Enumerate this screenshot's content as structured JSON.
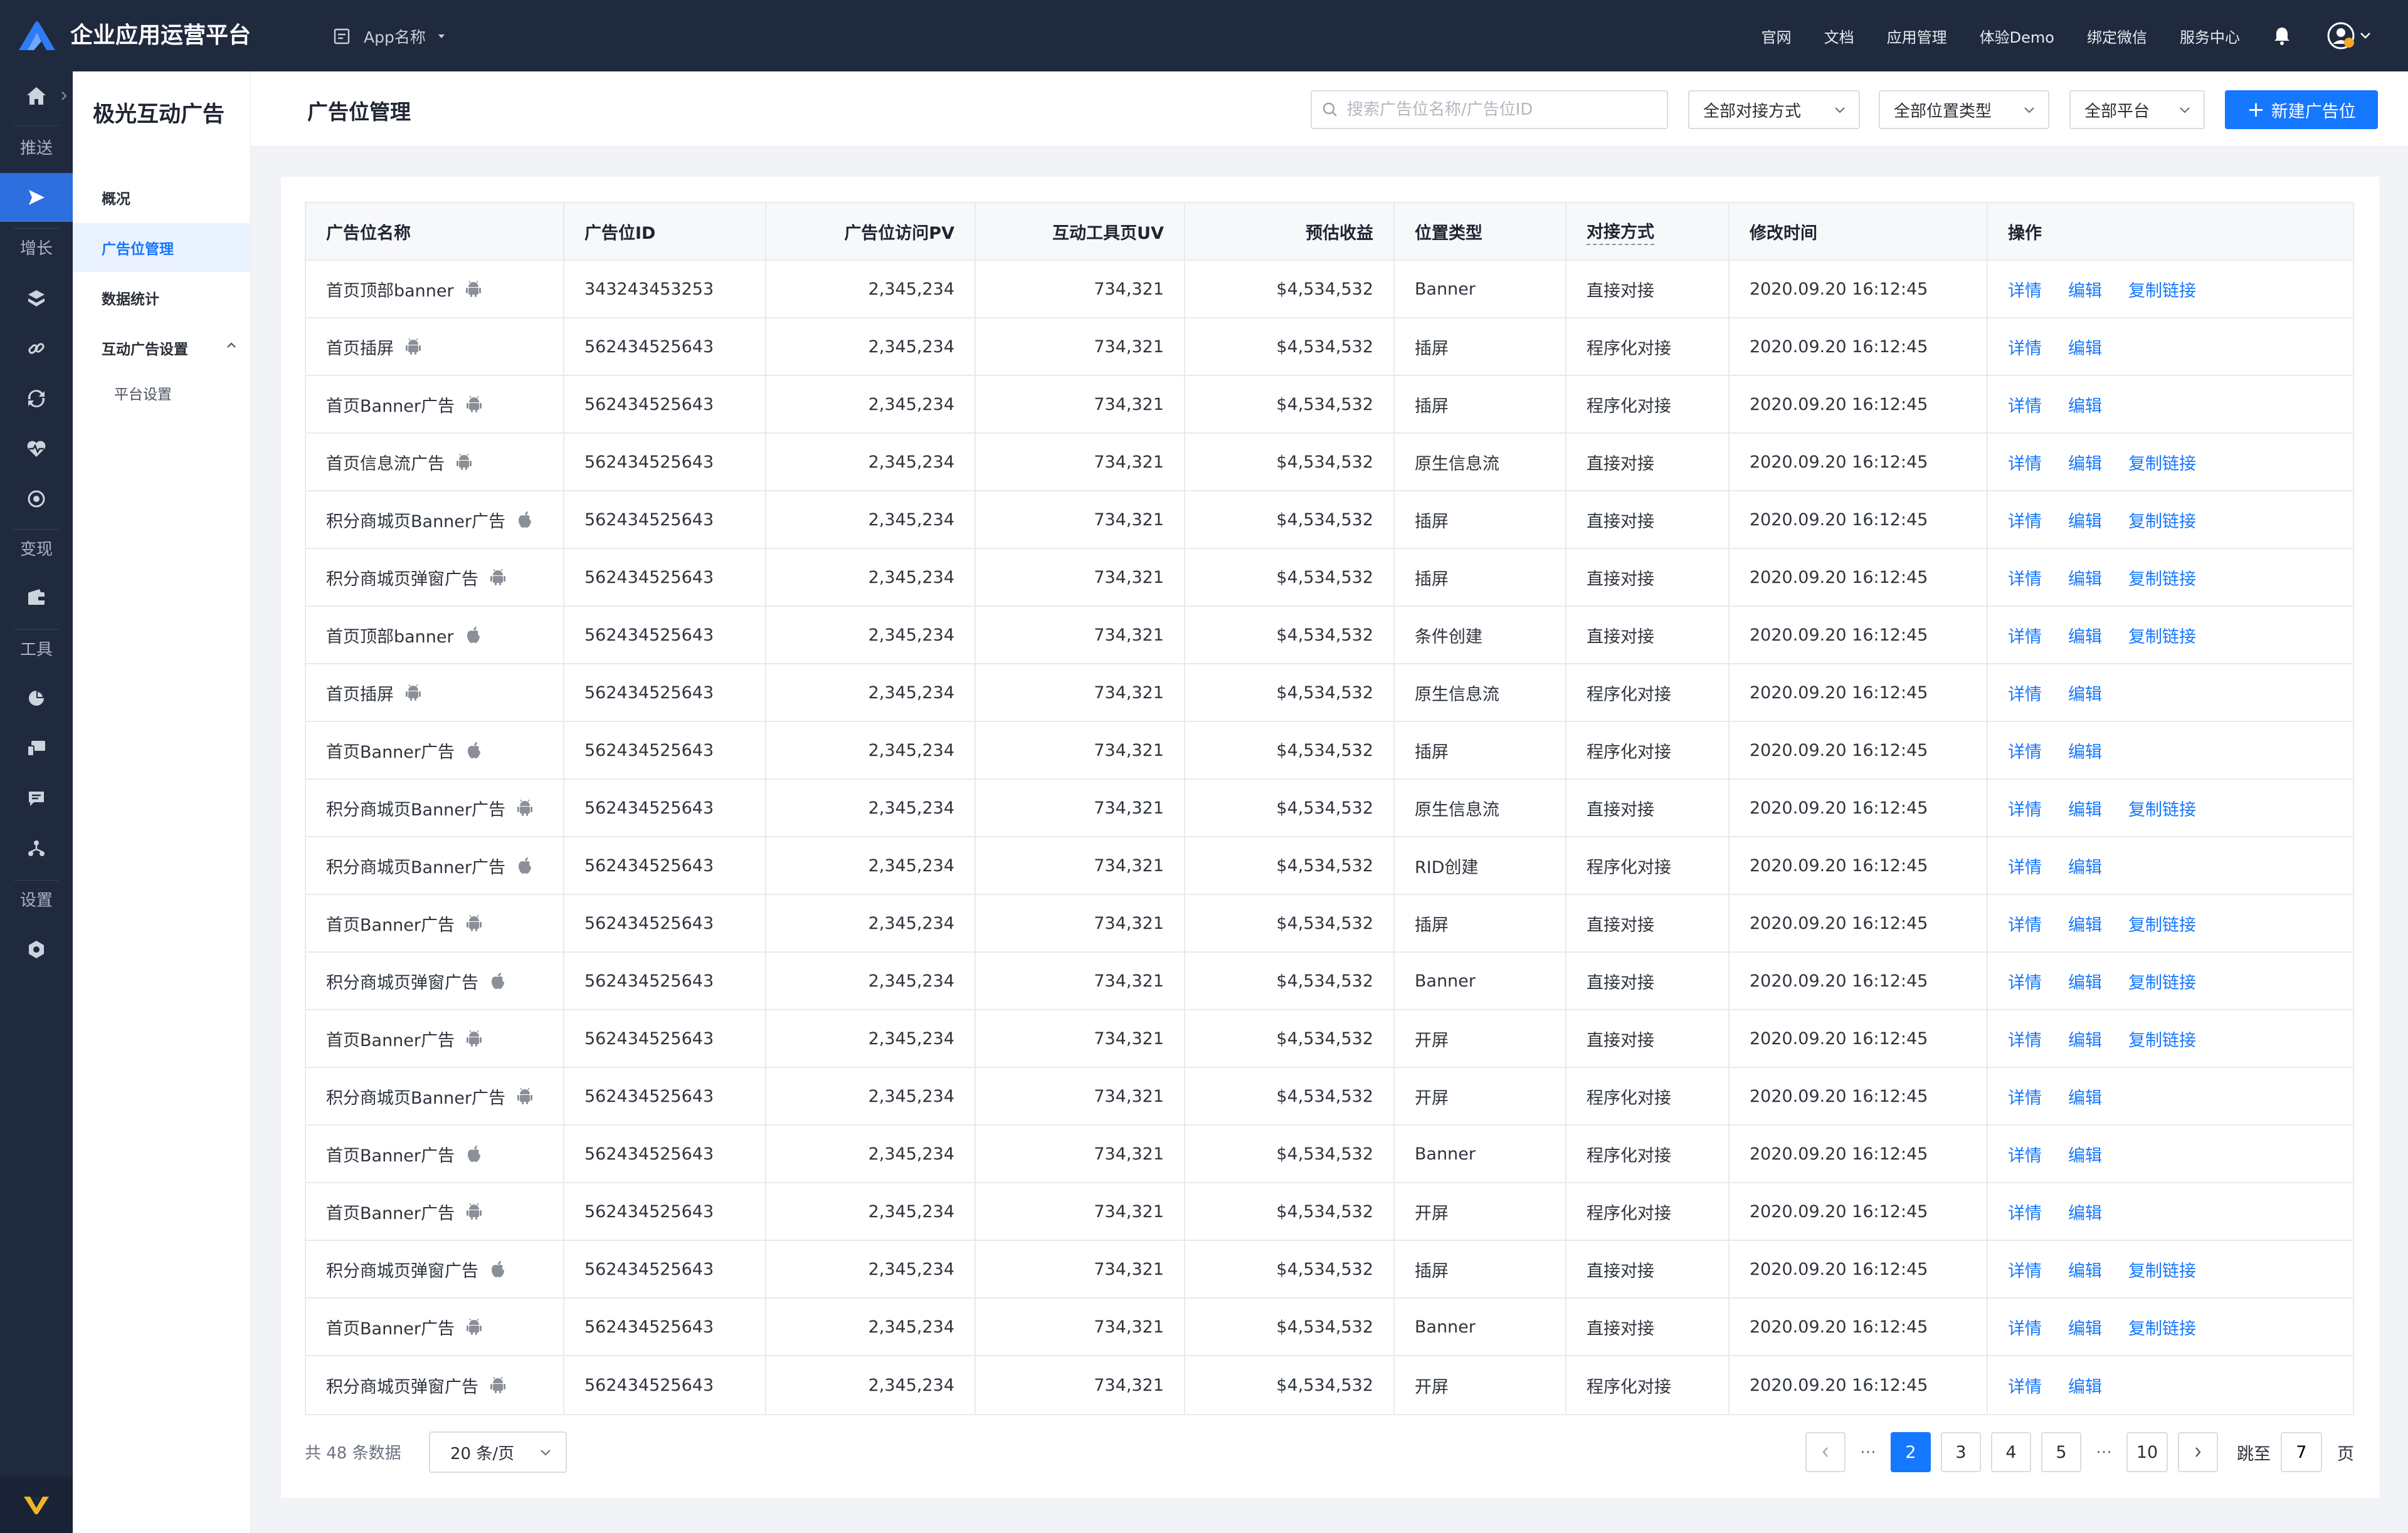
{
  "app": {
    "brand": "企业应用运营平台",
    "app_selector": "App名称",
    "nav": [
      "官网",
      "文档",
      "应用管理",
      "体验Demo",
      "绑定微信",
      "服务中心"
    ]
  },
  "rail": {
    "labels": {
      "push": "推送",
      "growth": "增长",
      "monetize": "变现",
      "tools": "工具",
      "settings": "设置"
    }
  },
  "sidebar": {
    "title": "极光互动广告",
    "items": [
      {
        "label": "概况"
      },
      {
        "label": "广告位管理"
      },
      {
        "label": "数据统计"
      },
      {
        "label": "互动广告设置"
      },
      {
        "label": "平台设置"
      }
    ]
  },
  "header": {
    "title": "广告位管理",
    "search_placeholder": "搜索广告位名称/广告位ID",
    "filter_connect": "全部对接方式",
    "filter_position": "全部位置类型",
    "filter_platform": "全部平台",
    "new_button": "新建广告位"
  },
  "table": {
    "columns": [
      "广告位名称",
      "广告位ID",
      "广告位访问PV",
      "互动工具页UV",
      "预估收益",
      "位置类型",
      "对接方式",
      "修改时间",
      "操作"
    ],
    "actions": {
      "detail": "详情",
      "edit": "编辑",
      "copy": "复制链接"
    },
    "rows": [
      {
        "name": "首页顶部banner",
        "platform": "android",
        "id": "343243453253",
        "pv": "2,345,234",
        "uv": "734,321",
        "revenue": "$4,534,532",
        "type": "Banner",
        "connect": "直接对接",
        "time": "2020.09.20 16:12:45",
        "copy": true
      },
      {
        "name": "首页插屏",
        "platform": "android",
        "id": "562434525643",
        "pv": "2,345,234",
        "uv": "734,321",
        "revenue": "$4,534,532",
        "type": "插屏",
        "connect": "程序化对接",
        "time": "2020.09.20 16:12:45",
        "copy": false
      },
      {
        "name": "首页Banner广告",
        "platform": "android",
        "id": "562434525643",
        "pv": "2,345,234",
        "uv": "734,321",
        "revenue": "$4,534,532",
        "type": "插屏",
        "connect": "程序化对接",
        "time": "2020.09.20 16:12:45",
        "copy": false
      },
      {
        "name": "首页信息流广告",
        "platform": "android",
        "id": "562434525643",
        "pv": "2,345,234",
        "uv": "734,321",
        "revenue": "$4,534,532",
        "type": "原生信息流",
        "connect": "直接对接",
        "time": "2020.09.20 16:12:45",
        "copy": true
      },
      {
        "name": "积分商城页Banner广告",
        "platform": "apple",
        "id": "562434525643",
        "pv": "2,345,234",
        "uv": "734,321",
        "revenue": "$4,534,532",
        "type": "插屏",
        "connect": "直接对接",
        "time": "2020.09.20 16:12:45",
        "copy": true
      },
      {
        "name": "积分商城页弹窗广告",
        "platform": "android",
        "id": "562434525643",
        "pv": "2,345,234",
        "uv": "734,321",
        "revenue": "$4,534,532",
        "type": "插屏",
        "connect": "直接对接",
        "time": "2020.09.20 16:12:45",
        "copy": true
      },
      {
        "name": "首页顶部banner",
        "platform": "apple",
        "id": "562434525643",
        "pv": "2,345,234",
        "uv": "734,321",
        "revenue": "$4,534,532",
        "type": "条件创建",
        "connect": "直接对接",
        "time": "2020.09.20 16:12:45",
        "copy": true
      },
      {
        "name": "首页插屏",
        "platform": "android",
        "id": "562434525643",
        "pv": "2,345,234",
        "uv": "734,321",
        "revenue": "$4,534,532",
        "type": "原生信息流",
        "connect": "程序化对接",
        "time": "2020.09.20 16:12:45",
        "copy": false
      },
      {
        "name": "首页Banner广告",
        "platform": "apple",
        "id": "562434525643",
        "pv": "2,345,234",
        "uv": "734,321",
        "revenue": "$4,534,532",
        "type": "插屏",
        "connect": "程序化对接",
        "time": "2020.09.20 16:12:45",
        "copy": false
      },
      {
        "name": "积分商城页Banner广告",
        "platform": "android",
        "id": "562434525643",
        "pv": "2,345,234",
        "uv": "734,321",
        "revenue": "$4,534,532",
        "type": "原生信息流",
        "connect": "直接对接",
        "time": "2020.09.20 16:12:45",
        "copy": true
      },
      {
        "name": "积分商城页Banner广告",
        "platform": "apple",
        "id": "562434525643",
        "pv": "2,345,234",
        "uv": "734,321",
        "revenue": "$4,534,532",
        "type": "RID创建",
        "connect": "程序化对接",
        "time": "2020.09.20 16:12:45",
        "copy": false
      },
      {
        "name": "首页Banner广告",
        "platform": "android",
        "id": "562434525643",
        "pv": "2,345,234",
        "uv": "734,321",
        "revenue": "$4,534,532",
        "type": "插屏",
        "connect": "直接对接",
        "time": "2020.09.20 16:12:45",
        "copy": true
      },
      {
        "name": "积分商城页弹窗广告",
        "platform": "apple",
        "id": "562434525643",
        "pv": "2,345,234",
        "uv": "734,321",
        "revenue": "$4,534,532",
        "type": "Banner",
        "connect": "直接对接",
        "time": "2020.09.20 16:12:45",
        "copy": true
      },
      {
        "name": "首页Banner广告",
        "platform": "android",
        "id": "562434525643",
        "pv": "2,345,234",
        "uv": "734,321",
        "revenue": "$4,534,532",
        "type": "开屏",
        "connect": "直接对接",
        "time": "2020.09.20 16:12:45",
        "copy": true
      },
      {
        "name": "积分商城页Banner广告",
        "platform": "android",
        "id": "562434525643",
        "pv": "2,345,234",
        "uv": "734,321",
        "revenue": "$4,534,532",
        "type": "开屏",
        "connect": "程序化对接",
        "time": "2020.09.20 16:12:45",
        "copy": false
      },
      {
        "name": "首页Banner广告",
        "platform": "apple",
        "id": "562434525643",
        "pv": "2,345,234",
        "uv": "734,321",
        "revenue": "$4,534,532",
        "type": "Banner",
        "connect": "程序化对接",
        "time": "2020.09.20 16:12:45",
        "copy": false
      },
      {
        "name": "首页Banner广告",
        "platform": "android",
        "id": "562434525643",
        "pv": "2,345,234",
        "uv": "734,321",
        "revenue": "$4,534,532",
        "type": "开屏",
        "connect": "程序化对接",
        "time": "2020.09.20 16:12:45",
        "copy": false
      },
      {
        "name": "积分商城页弹窗广告",
        "platform": "apple",
        "id": "562434525643",
        "pv": "2,345,234",
        "uv": "734,321",
        "revenue": "$4,534,532",
        "type": "插屏",
        "connect": "直接对接",
        "time": "2020.09.20 16:12:45",
        "copy": true
      },
      {
        "name": "首页Banner广告",
        "platform": "android",
        "id": "562434525643",
        "pv": "2,345,234",
        "uv": "734,321",
        "revenue": "$4,534,532",
        "type": "Banner",
        "connect": "直接对接",
        "time": "2020.09.20 16:12:45",
        "copy": true
      },
      {
        "name": "积分商城页弹窗广告",
        "platform": "android",
        "id": "562434525643",
        "pv": "2,345,234",
        "uv": "734,321",
        "revenue": "$4,534,532",
        "type": "开屏",
        "connect": "程序化对接",
        "time": "2020.09.20 16:12:45",
        "copy": false
      }
    ]
  },
  "pagination": {
    "total_text": "共 48 条数据",
    "page_size": "20 条/页",
    "ellipsis": "···",
    "pages": [
      "2",
      "3",
      "4",
      "5",
      "10"
    ],
    "current": "2",
    "jump_label": "跳至",
    "jump_value": "7",
    "page_unit": "页"
  },
  "colors": {
    "topbar": "#1f2a3e",
    "accent": "#1677ff",
    "icon_gray": "#8a8f98"
  }
}
